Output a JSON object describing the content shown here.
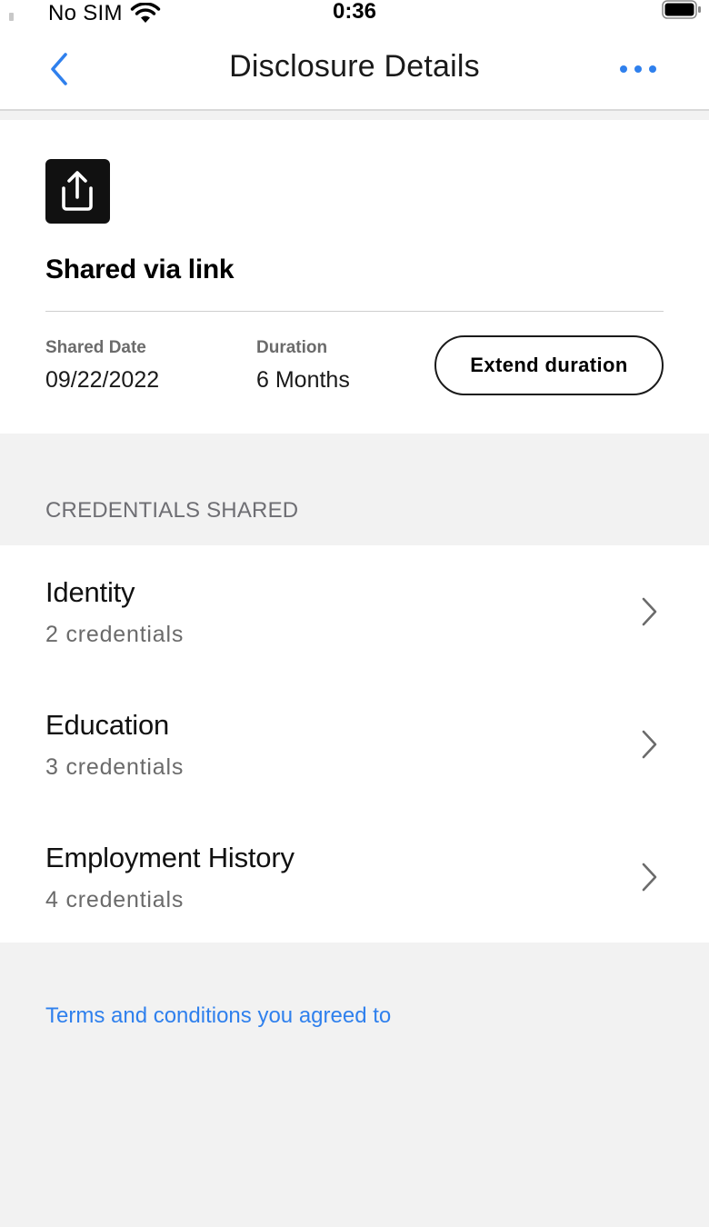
{
  "status_bar": {
    "carrier": "No SIM",
    "time": "0:36"
  },
  "nav": {
    "title": "Disclosure Details"
  },
  "disclosure": {
    "title": "Shared via link",
    "shared_date_label": "Shared Date",
    "shared_date_value": "09/22/2022",
    "duration_label": "Duration",
    "duration_value": "6 Months",
    "extend_label": "Extend duration"
  },
  "credentials": {
    "section_title": "CREDENTIALS SHARED",
    "items": [
      {
        "title": "Identity",
        "subtitle": "2 credentials"
      },
      {
        "title": "Education",
        "subtitle": "3 credentials"
      },
      {
        "title": "Employment History",
        "subtitle": "4 credentials"
      }
    ]
  },
  "footer": {
    "terms_link": "Terms and conditions you agreed to"
  },
  "colors": {
    "accent": "#2f80ed",
    "background": "#f2f2f2",
    "card": "#ffffff"
  }
}
